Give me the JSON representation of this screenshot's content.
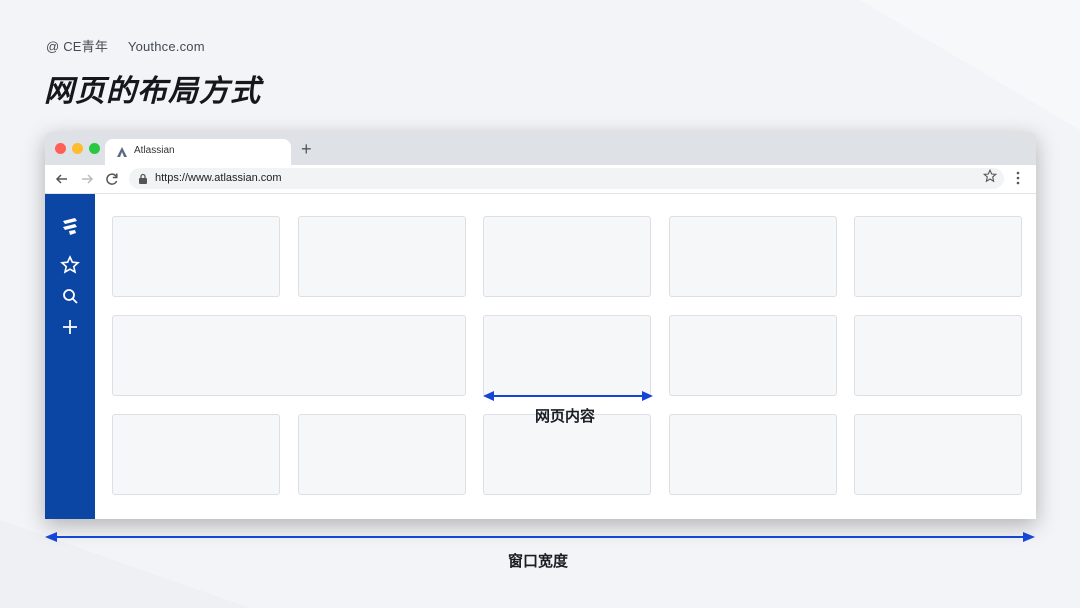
{
  "credit": {
    "at": "@ CE青年",
    "site": "Youthce.com"
  },
  "page_title": "网页的布局方式",
  "browser": {
    "tab_title": "Atlassian",
    "new_tab": "+",
    "url": "https://www.atlassian.com",
    "traffic_lights": [
      "#ff5f57",
      "#febc2e",
      "#28c840"
    ]
  },
  "sidebar": {
    "color": "#0b46a5",
    "icons": [
      "jira-logo-icon",
      "star-icon",
      "search-icon",
      "plus-icon"
    ]
  },
  "annotations": {
    "content_label": "网页内容",
    "window_label": "窗口宽度",
    "arrow_color": "#1546d6"
  }
}
